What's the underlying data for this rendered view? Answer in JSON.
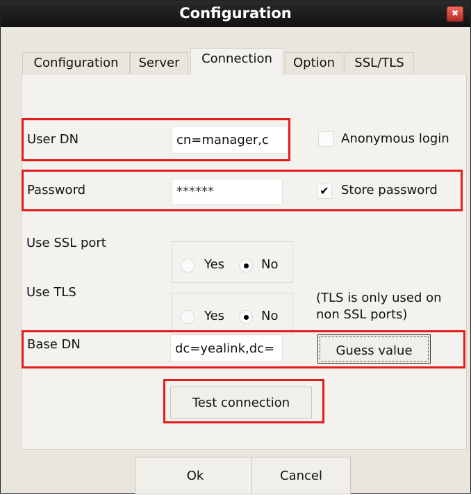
{
  "window": {
    "title": "Configuration",
    "close_glyph": "✖"
  },
  "tabs": [
    {
      "label": "Configuration"
    },
    {
      "label": "Server"
    },
    {
      "label": "Connection",
      "active": true
    },
    {
      "label": "Option"
    },
    {
      "label": "SSL/TLS"
    }
  ],
  "form": {
    "user_dn": {
      "label": "User DN",
      "value": "cn=manager,c"
    },
    "anonymous_login": {
      "label": "Anonymous login",
      "checked": false
    },
    "password": {
      "label": "Password",
      "value": "******"
    },
    "store_password": {
      "label": "Store password",
      "checked": true,
      "check_glyph": "✔"
    },
    "use_ssl_port": {
      "label": "Use SSL port",
      "yes": "Yes",
      "no": "No",
      "selected": "No"
    },
    "use_tls": {
      "label": "Use TLS",
      "yes": "Yes",
      "no": "No",
      "selected": "No",
      "note": "(TLS is only used on non SSL ports)"
    },
    "base_dn": {
      "label": "Base DN",
      "value": "dc=yealink,dc="
    },
    "guess_value_label": "Guess value",
    "test_connection_label": "Test connection"
  },
  "footer": {
    "ok_label": "Ok",
    "cancel_label": "Cancel"
  },
  "colors": {
    "highlight": "#e51a1a",
    "titlebar": "#1c1c1c",
    "close_button": "#d9453a"
  },
  "icons": {
    "close": "close-icon",
    "check": "check-icon",
    "radio": "radio-icon"
  }
}
